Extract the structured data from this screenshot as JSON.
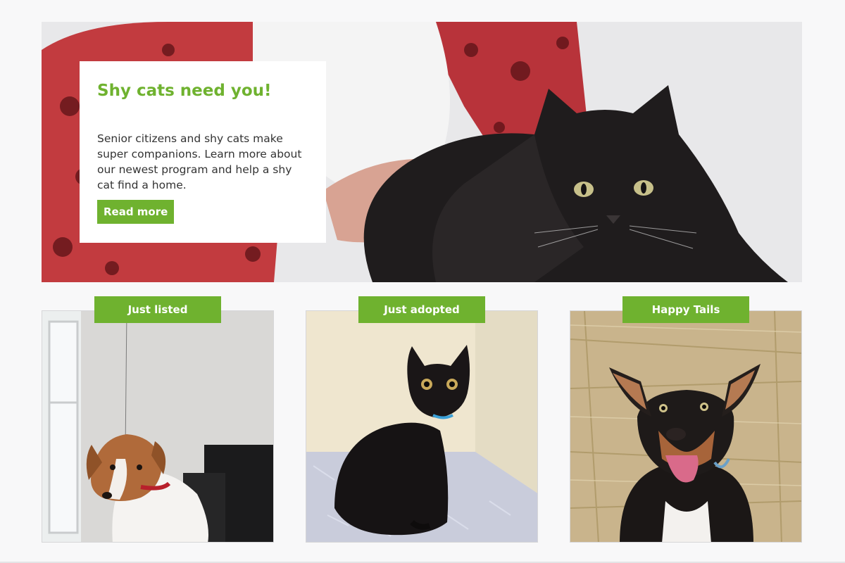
{
  "hero": {
    "title": "Shy cats need you!",
    "body": "Senior citizens and shy cats make super companions. Learn more about our newest program and help a shy cat find a home.",
    "cta_label": "Read more",
    "image": "senior-woman-holding-black-cat-photo"
  },
  "tiles": [
    {
      "label": "Just listed",
      "image": "jack-russell-dog-photo"
    },
    {
      "label": "Just adopted",
      "image": "black-kitten-photo"
    },
    {
      "label": "Happy Tails",
      "image": "kelpie-dog-hay-bales-photo"
    }
  ],
  "colors": {
    "accent": "#6fb22f",
    "page_background": "#f8f8f9",
    "body_text": "#333333"
  }
}
